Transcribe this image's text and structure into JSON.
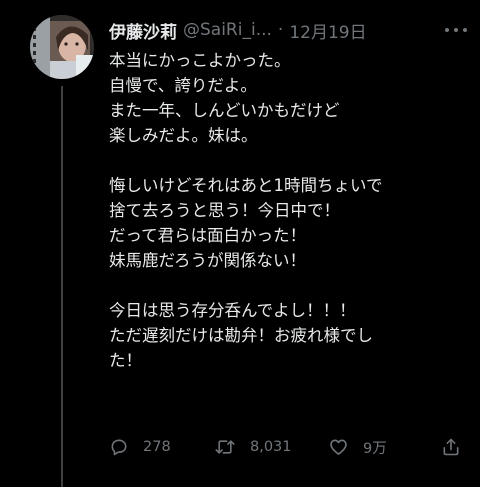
{
  "tweet": {
    "author": {
      "display_name": "伊藤沙莉",
      "handle": "@SaiRi_i..."
    },
    "separator": "·",
    "date": "12月19日",
    "more_icon": "more-horizontal-icon",
    "lines": [
      "本当にかっこよかった。",
      "自慢で、誇りだよ。",
      "また一年、しんどいかもだけど",
      "楽しみだよ。妹は。",
      "",
      "悔しいけどそれはあと1時間ちょいで",
      "捨て去ろうと思う！今日中で！",
      "だって君らは面白かった！",
      "妹馬鹿だろうが関係ない！",
      "",
      "今日は思う存分呑んでよし！！！",
      "ただ遅刻だけは勘弁！お疲れ様でし",
      "た！"
    ],
    "actions": {
      "reply": {
        "icon": "reply-icon",
        "count": "278"
      },
      "retweet": {
        "icon": "retweet-icon",
        "count": "8,031"
      },
      "like": {
        "icon": "heart-icon",
        "count": "9万"
      },
      "share": {
        "icon": "share-icon"
      }
    }
  },
  "colors": {
    "background": "#000000",
    "text": "#e7e9ea",
    "secondary": "#71767b",
    "thread_line": "#3d4144"
  }
}
